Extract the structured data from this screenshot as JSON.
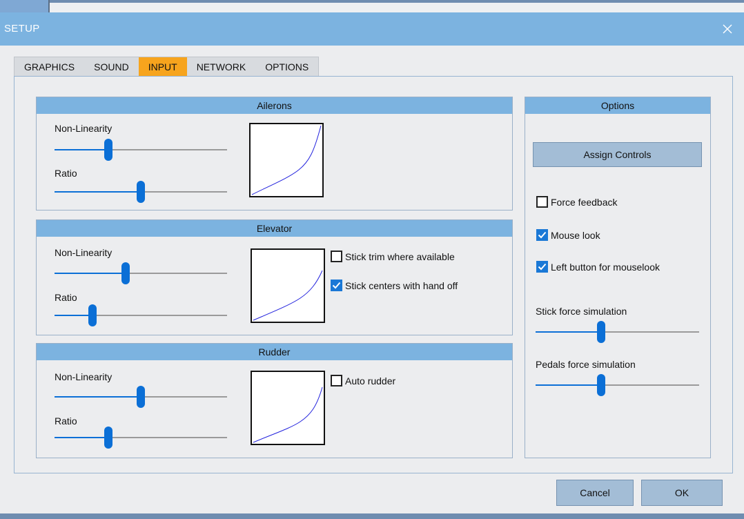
{
  "window": {
    "title": "SETUP"
  },
  "tabs": [
    {
      "label": "GRAPHICS",
      "active": false
    },
    {
      "label": "SOUND",
      "active": false
    },
    {
      "label": "INPUT",
      "active": true
    },
    {
      "label": "NETWORK",
      "active": false
    },
    {
      "label": "OPTIONS",
      "active": false
    }
  ],
  "ailerons": {
    "title": "Ailerons",
    "nonlinearity_label": "Non-Linearity",
    "nonlinearity_value": 0.31,
    "ratio_label": "Ratio",
    "ratio_value": 0.5
  },
  "elevator": {
    "title": "Elevator",
    "nonlinearity_label": "Non-Linearity",
    "nonlinearity_value": 0.41,
    "ratio_label": "Ratio",
    "ratio_value": 0.22,
    "stick_trim_label": "Stick trim where available",
    "stick_trim_checked": false,
    "stick_centers_label": "Stick centers with hand off",
    "stick_centers_checked": true
  },
  "rudder": {
    "title": "Rudder",
    "nonlinearity_label": "Non-Linearity",
    "nonlinearity_value": 0.5,
    "ratio_label": "Ratio",
    "ratio_value": 0.31,
    "auto_rudder_label": "Auto rudder",
    "auto_rudder_checked": false
  },
  "options": {
    "title": "Options",
    "assign_controls_label": "Assign Controls",
    "force_feedback_label": "Force feedback",
    "force_feedback_checked": false,
    "mouse_look_label": "Mouse look",
    "mouse_look_checked": true,
    "left_button_label": "Left button for mouselook",
    "left_button_checked": true,
    "stick_force_label": "Stick force simulation",
    "stick_force_value": 0.4,
    "pedals_force_label": "Pedals force simulation",
    "pedals_force_value": 0.4
  },
  "footer": {
    "cancel_label": "Cancel",
    "ok_label": "OK"
  },
  "colors": {
    "accent_tab": "#f7a41d",
    "header_blue": "#7cb3e0",
    "slider_blue": "#0b6fd6",
    "curve_line": "#2222dd"
  }
}
